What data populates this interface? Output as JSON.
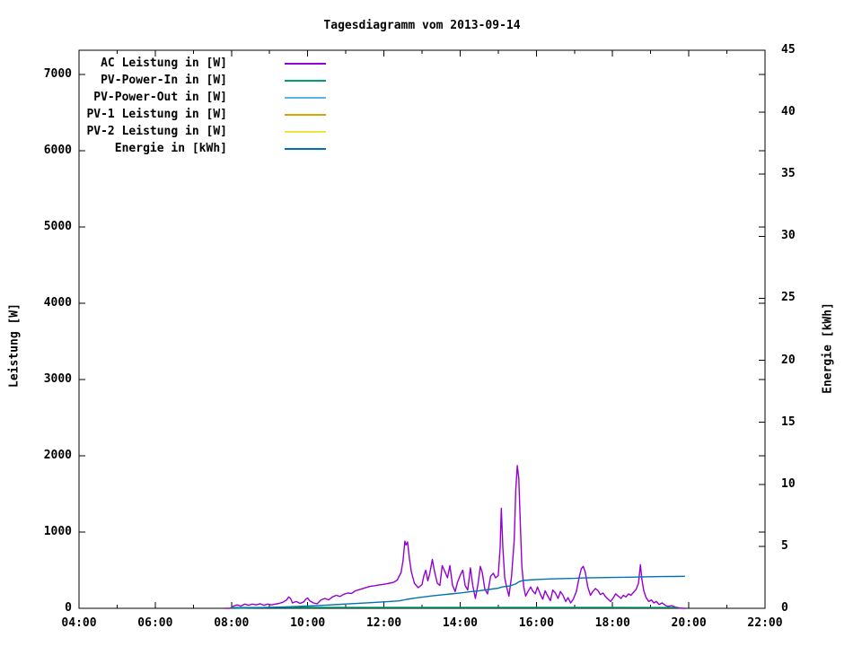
{
  "chart_data": {
    "type": "line",
    "title": "Tagesdiagramm vom 2013-09-14",
    "x_axis": {
      "range_hours": [
        4,
        22
      ],
      "major_tick_labels": [
        "04:00",
        "06:00",
        "08:00",
        "10:00",
        "12:00",
        "14:00",
        "16:00",
        "18:00",
        "20:00",
        "22:00"
      ],
      "major_tick_hours": [
        4,
        6,
        8,
        10,
        12,
        14,
        16,
        18,
        20,
        22
      ],
      "minor_tick_hours": [
        5,
        7,
        9,
        11,
        13,
        15,
        17,
        19,
        21
      ]
    },
    "y_axis": {
      "label": "Leistung [W]",
      "range": [
        0,
        7320
      ],
      "tick_values": [
        0,
        1000,
        2000,
        3000,
        4000,
        5000,
        6000,
        7000
      ],
      "tick_labels": [
        "0",
        "1000",
        "2000",
        "3000",
        "4000",
        "5000",
        "6000",
        "7000"
      ]
    },
    "y2_axis": {
      "label": "Energie [kWh]",
      "range": [
        0,
        45
      ],
      "tick_values": [
        0,
        5,
        10,
        15,
        20,
        25,
        30,
        35,
        40,
        45
      ],
      "tick_labels": [
        "0",
        "5",
        "10",
        "15",
        "20",
        "25",
        "30",
        "35",
        "40",
        "45"
      ]
    },
    "grid": false,
    "legend_position": "top-left-inside",
    "series": [
      {
        "name": "AC Leistung in [W]",
        "color": "#9400d3",
        "axis": "y",
        "points": [
          [
            7.83,
            0
          ],
          [
            7.95,
            0
          ],
          [
            8.0,
            5
          ],
          [
            8.05,
            30
          ],
          [
            8.15,
            45
          ],
          [
            8.25,
            30
          ],
          [
            8.35,
            55
          ],
          [
            8.45,
            40
          ],
          [
            8.55,
            55
          ],
          [
            8.65,
            45
          ],
          [
            8.75,
            60
          ],
          [
            8.85,
            40
          ],
          [
            8.95,
            55
          ],
          [
            9.05,
            45
          ],
          [
            9.15,
            55
          ],
          [
            9.25,
            65
          ],
          [
            9.35,
            80
          ],
          [
            9.45,
            110
          ],
          [
            9.5,
            150
          ],
          [
            9.55,
            130
          ],
          [
            9.6,
            70
          ],
          [
            9.7,
            90
          ],
          [
            9.8,
            65
          ],
          [
            9.9,
            85
          ],
          [
            9.95,
            120
          ],
          [
            10.0,
            135
          ],
          [
            10.05,
            100
          ],
          [
            10.15,
            70
          ],
          [
            10.25,
            60
          ],
          [
            10.35,
            110
          ],
          [
            10.45,
            130
          ],
          [
            10.55,
            110
          ],
          [
            10.65,
            150
          ],
          [
            10.75,
            170
          ],
          [
            10.85,
            155
          ],
          [
            10.95,
            185
          ],
          [
            11.05,
            200
          ],
          [
            11.15,
            195
          ],
          [
            11.25,
            230
          ],
          [
            11.35,
            245
          ],
          [
            11.45,
            260
          ],
          [
            11.55,
            275
          ],
          [
            11.65,
            290
          ],
          [
            11.75,
            295
          ],
          [
            11.85,
            305
          ],
          [
            11.95,
            310
          ],
          [
            12.05,
            320
          ],
          [
            12.15,
            330
          ],
          [
            12.25,
            340
          ],
          [
            12.35,
            370
          ],
          [
            12.45,
            470
          ],
          [
            12.5,
            620
          ],
          [
            12.55,
            880
          ],
          [
            12.58,
            830
          ],
          [
            12.62,
            870
          ],
          [
            12.67,
            650
          ],
          [
            12.72,
            480
          ],
          [
            12.8,
            330
          ],
          [
            12.9,
            270
          ],
          [
            13.0,
            310
          ],
          [
            13.05,
            430
          ],
          [
            13.1,
            500
          ],
          [
            13.15,
            360
          ],
          [
            13.2,
            450
          ],
          [
            13.27,
            640
          ],
          [
            13.33,
            480
          ],
          [
            13.4,
            330
          ],
          [
            13.47,
            300
          ],
          [
            13.53,
            560
          ],
          [
            13.6,
            480
          ],
          [
            13.67,
            400
          ],
          [
            13.73,
            560
          ],
          [
            13.8,
            300
          ],
          [
            13.87,
            220
          ],
          [
            13.93,
            340
          ],
          [
            14.0,
            430
          ],
          [
            14.07,
            500
          ],
          [
            14.13,
            300
          ],
          [
            14.2,
            240
          ],
          [
            14.27,
            530
          ],
          [
            14.33,
            300
          ],
          [
            14.4,
            130
          ],
          [
            14.47,
            320
          ],
          [
            14.53,
            550
          ],
          [
            14.58,
            470
          ],
          [
            14.65,
            250
          ],
          [
            14.72,
            190
          ],
          [
            14.8,
            420
          ],
          [
            14.87,
            460
          ],
          [
            14.93,
            400
          ],
          [
            15.0,
            430
          ],
          [
            15.05,
            800
          ],
          [
            15.08,
            1310
          ],
          [
            15.12,
            800
          ],
          [
            15.17,
            400
          ],
          [
            15.22,
            280
          ],
          [
            15.28,
            160
          ],
          [
            15.35,
            420
          ],
          [
            15.42,
            900
          ],
          [
            15.46,
            1550
          ],
          [
            15.5,
            1870
          ],
          [
            15.54,
            1700
          ],
          [
            15.58,
            1100
          ],
          [
            15.62,
            550
          ],
          [
            15.67,
            280
          ],
          [
            15.72,
            160
          ],
          [
            15.78,
            220
          ],
          [
            15.85,
            280
          ],
          [
            15.9,
            230
          ],
          [
            15.97,
            190
          ],
          [
            16.03,
            280
          ],
          [
            16.1,
            190
          ],
          [
            16.17,
            120
          ],
          [
            16.23,
            230
          ],
          [
            16.3,
            160
          ],
          [
            16.37,
            100
          ],
          [
            16.43,
            240
          ],
          [
            16.5,
            200
          ],
          [
            16.57,
            130
          ],
          [
            16.63,
            220
          ],
          [
            16.7,
            170
          ],
          [
            16.77,
            90
          ],
          [
            16.83,
            140
          ],
          [
            16.9,
            70
          ],
          [
            16.97,
            120
          ],
          [
            17.05,
            220
          ],
          [
            17.12,
            400
          ],
          [
            17.18,
            520
          ],
          [
            17.23,
            550
          ],
          [
            17.28,
            480
          ],
          [
            17.35,
            280
          ],
          [
            17.42,
            170
          ],
          [
            17.48,
            220
          ],
          [
            17.55,
            260
          ],
          [
            17.62,
            230
          ],
          [
            17.68,
            180
          ],
          [
            17.75,
            200
          ],
          [
            17.82,
            150
          ],
          [
            17.88,
            120
          ],
          [
            17.95,
            90
          ],
          [
            18.02,
            140
          ],
          [
            18.08,
            190
          ],
          [
            18.15,
            160
          ],
          [
            18.22,
            130
          ],
          [
            18.28,
            170
          ],
          [
            18.35,
            150
          ],
          [
            18.42,
            190
          ],
          [
            18.48,
            170
          ],
          [
            18.55,
            210
          ],
          [
            18.62,
            250
          ],
          [
            18.68,
            330
          ],
          [
            18.73,
            570
          ],
          [
            18.77,
            380
          ],
          [
            18.82,
            230
          ],
          [
            18.88,
            140
          ],
          [
            18.95,
            90
          ],
          [
            19.02,
            110
          ],
          [
            19.08,
            70
          ],
          [
            19.15,
            90
          ],
          [
            19.22,
            50
          ],
          [
            19.3,
            70
          ],
          [
            19.38,
            40
          ],
          [
            19.45,
            25
          ],
          [
            19.55,
            35
          ],
          [
            19.65,
            15
          ],
          [
            19.75,
            5
          ],
          [
            19.85,
            0
          ],
          [
            19.92,
            0
          ]
        ]
      },
      {
        "name": "PV-Power-In in [W]",
        "color": "#009e73",
        "axis": "y",
        "points": [
          [
            8.0,
            10
          ],
          [
            9.0,
            10
          ],
          [
            10.0,
            12
          ],
          [
            11.0,
            12
          ],
          [
            12.0,
            12
          ],
          [
            13.0,
            12
          ],
          [
            14.0,
            12
          ],
          [
            15.0,
            12
          ],
          [
            16.0,
            12
          ],
          [
            17.0,
            12
          ],
          [
            18.0,
            12
          ],
          [
            19.0,
            10
          ],
          [
            19.7,
            10
          ]
        ]
      },
      {
        "name": "PV-Power-Out in [W]",
        "color": "#56b4e9",
        "axis": "y",
        "points": []
      },
      {
        "name": "PV-1 Leistung in [W]",
        "color": "#e69f00",
        "axis": "y",
        "points": []
      },
      {
        "name": "PV-2 Leistung in [W]",
        "color": "#f0e442",
        "axis": "y",
        "points": []
      },
      {
        "name": "Energie in [kWh]",
        "color": "#0072b2",
        "axis": "y2",
        "points": [
          [
            8.0,
            0
          ],
          [
            8.5,
            0.03
          ],
          [
            9.0,
            0.07
          ],
          [
            9.5,
            0.12
          ],
          [
            10.0,
            0.18
          ],
          [
            10.5,
            0.26
          ],
          [
            11.0,
            0.35
          ],
          [
            11.5,
            0.43
          ],
          [
            12.0,
            0.52
          ],
          [
            12.4,
            0.6
          ],
          [
            12.6,
            0.72
          ],
          [
            12.8,
            0.82
          ],
          [
            13.0,
            0.9
          ],
          [
            13.25,
            1.0
          ],
          [
            13.5,
            1.08
          ],
          [
            13.75,
            1.16
          ],
          [
            14.0,
            1.24
          ],
          [
            14.25,
            1.33
          ],
          [
            14.5,
            1.42
          ],
          [
            14.75,
            1.52
          ],
          [
            15.0,
            1.62
          ],
          [
            15.1,
            1.72
          ],
          [
            15.3,
            1.8
          ],
          [
            15.45,
            1.95
          ],
          [
            15.55,
            2.15
          ],
          [
            15.65,
            2.25
          ],
          [
            15.8,
            2.28
          ],
          [
            16.0,
            2.32
          ],
          [
            16.25,
            2.36
          ],
          [
            16.5,
            2.38
          ],
          [
            17.0,
            2.42
          ],
          [
            17.25,
            2.45
          ],
          [
            17.5,
            2.47
          ],
          [
            18.0,
            2.49
          ],
          [
            18.5,
            2.51
          ],
          [
            18.8,
            2.54
          ],
          [
            19.0,
            2.55
          ],
          [
            19.3,
            2.56
          ],
          [
            19.6,
            2.57
          ],
          [
            19.9,
            2.58
          ]
        ]
      }
    ]
  }
}
